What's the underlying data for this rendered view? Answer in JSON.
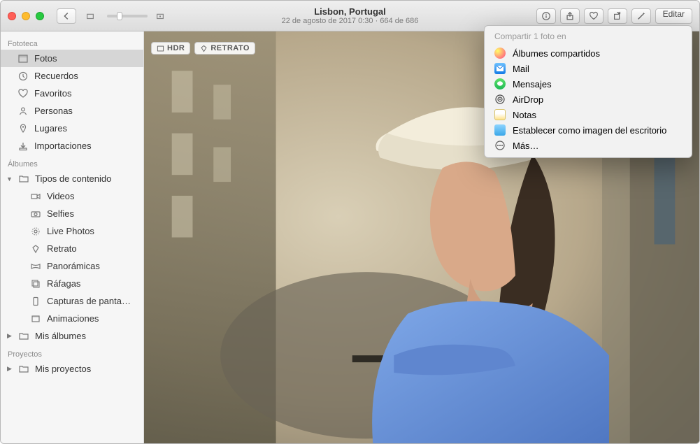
{
  "title": "Lisbon, Portugal",
  "subtitle": "22 de agosto de 2017 0:30  ·  664 de 686",
  "toolbar": {
    "editar": "Editar"
  },
  "badges": {
    "hdr": "HDR",
    "retrato": "RETRATO"
  },
  "sidebar": {
    "section_fototeca": "Fototeca",
    "items_fototeca": [
      {
        "label": "Fotos"
      },
      {
        "label": "Recuerdos"
      },
      {
        "label": "Favoritos"
      },
      {
        "label": "Personas"
      },
      {
        "label": "Lugares"
      },
      {
        "label": "Importaciones"
      }
    ],
    "section_albumes": "Álbumes",
    "tipos_label": "Tipos de contenido",
    "tipos": [
      {
        "label": "Videos"
      },
      {
        "label": "Selfies"
      },
      {
        "label": "Live Photos"
      },
      {
        "label": "Retrato"
      },
      {
        "label": "Panorámicas"
      },
      {
        "label": "Ráfagas"
      },
      {
        "label": "Capturas de panta…"
      },
      {
        "label": "Animaciones"
      }
    ],
    "mis_albumes": "Mis álbumes",
    "section_proyectos": "Proyectos",
    "mis_proyectos": "Mis proyectos"
  },
  "share": {
    "header": "Compartir 1 foto en",
    "items": [
      {
        "label": "Álbumes compartidos"
      },
      {
        "label": "Mail"
      },
      {
        "label": "Mensajes"
      },
      {
        "label": "AirDrop"
      },
      {
        "label": "Notas"
      },
      {
        "label": "Establecer como imagen del escritorio"
      },
      {
        "label": "Más…"
      }
    ]
  }
}
